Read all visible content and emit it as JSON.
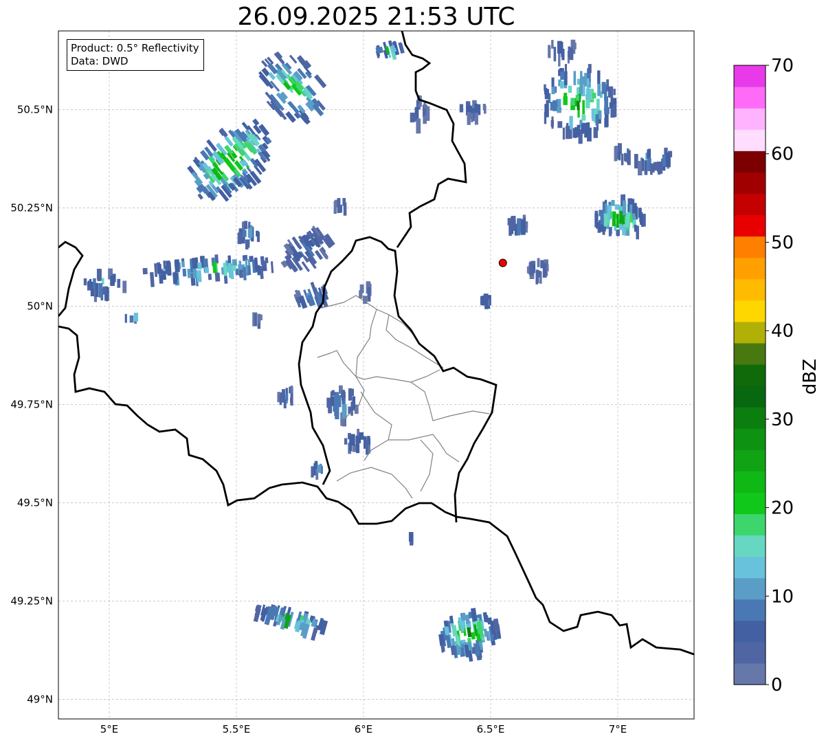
{
  "title": "26.09.2025 21:53 UTC",
  "info": {
    "product": "Product: 0.5° Reflectivity",
    "data": "Data: DWD"
  },
  "map": {
    "lon_range": [
      4.8,
      7.3
    ],
    "lat_range": [
      48.95,
      50.7
    ],
    "lon_ticks": [
      {
        "value": 5.0,
        "label": "5°E"
      },
      {
        "value": 5.5,
        "label": "5.5°E"
      },
      {
        "value": 6.0,
        "label": "6°E"
      },
      {
        "value": 6.5,
        "label": "6.5°E"
      },
      {
        "value": 7.0,
        "label": "7°E"
      }
    ],
    "lat_ticks": [
      {
        "value": 50.5,
        "label": "50.5°N"
      },
      {
        "value": 50.25,
        "label": "50.25°N"
      },
      {
        "value": 50.0,
        "label": "50°N"
      },
      {
        "value": 49.75,
        "label": "49.75°N"
      },
      {
        "value": 49.5,
        "label": "49.5°N"
      },
      {
        "value": 49.25,
        "label": "49.25°N"
      },
      {
        "value": 49.0,
        "label": "49°N"
      }
    ],
    "grid": true,
    "radar_site": {
      "lon": 6.548,
      "lat": 50.11,
      "color": "#ee0000"
    }
  },
  "colorbar": {
    "label": "dBZ",
    "vmin": 0,
    "vmax": 70,
    "ticks": [
      "0",
      "10",
      "20",
      "30",
      "40",
      "50",
      "60",
      "70"
    ],
    "colors": [
      "#6677aa",
      "#5066a4",
      "#4260a2",
      "#4a78b4",
      "#5a9ec8",
      "#68c2dc",
      "#66d8c2",
      "#3cd66c",
      "#10c81a",
      "#10b816",
      "#10a414",
      "#0e9212",
      "#0c7e10",
      "#086810",
      "#106a0a",
      "#487810",
      "#b0b006",
      "#ffd700",
      "#ffbb00",
      "#ff9f00",
      "#ff7f00",
      "#e80000",
      "#c40000",
      "#a00000",
      "#7c0000",
      "#ffddff",
      "#ffb3ff",
      "#ff6bf7",
      "#e83ae8"
    ]
  },
  "chart_data": {
    "type": "heatmap",
    "title": "26.09.2025 21:53 UTC",
    "xlabel": "",
    "ylabel": "",
    "colorbar_label": "dBZ",
    "xlim": [
      4.8,
      7.3
    ],
    "ylim": [
      48.95,
      50.7
    ],
    "value_range": [
      0,
      70
    ],
    "echo_cells": [
      {
        "lon": 5.45,
        "lat": 50.38,
        "peak_dbz": 33
      },
      {
        "lon": 5.55,
        "lat": 50.6,
        "peak_dbz": 28
      },
      {
        "lon": 5.35,
        "lat": 50.12,
        "peak_dbz": 26
      },
      {
        "lon": 6.83,
        "lat": 50.53,
        "peak_dbz": 30
      },
      {
        "lon": 6.98,
        "lat": 50.24,
        "peak_dbz": 32
      },
      {
        "lon": 6.38,
        "lat": 49.15,
        "peak_dbz": 33
      },
      {
        "lon": 5.68,
        "lat": 49.21,
        "peak_dbz": 28
      },
      {
        "lon": 6.1,
        "lat": 50.65,
        "peak_dbz": 24
      },
      {
        "lon": 5.9,
        "lat": 49.8,
        "peak_dbz": 16
      }
    ]
  }
}
